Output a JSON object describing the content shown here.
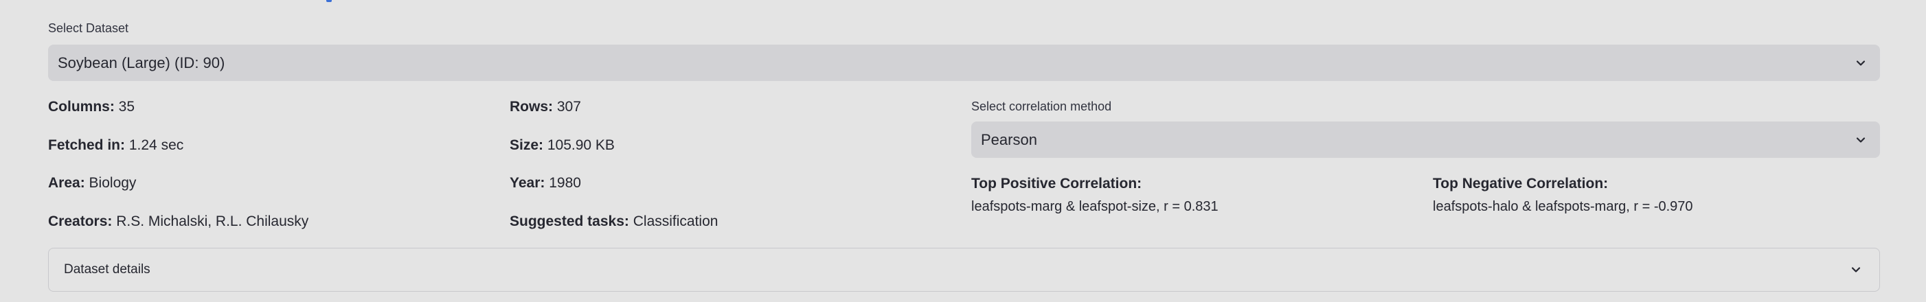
{
  "dataset_select": {
    "label": "Select Dataset",
    "value": "Soybean (Large) (ID: 90)"
  },
  "info": {
    "columns": {
      "label": "Columns:",
      "value": "35"
    },
    "rows": {
      "label": "Rows:",
      "value": "307"
    },
    "fetched_in": {
      "label": "Fetched in:",
      "value": "1.24 sec"
    },
    "size": {
      "label": "Size:",
      "value": "105.90 KB"
    },
    "area": {
      "label": "Area:",
      "value": "Biology"
    },
    "year": {
      "label": "Year:",
      "value": "1980"
    },
    "creators": {
      "label": "Creators:",
      "value": "R.S. Michalski, R.L. Chilausky"
    },
    "tasks": {
      "label": "Suggested tasks:",
      "value": "Classification"
    }
  },
  "correlation": {
    "label": "Select correlation method",
    "value": "Pearson",
    "top_positive": {
      "title": "Top Positive Correlation:",
      "value": "leafspots-marg & leafspot-size, r = 0.831"
    },
    "top_negative": {
      "title": "Top Negative Correlation:",
      "value": "leafspots-halo & leafspots-marg, r = -0.970"
    }
  },
  "details": {
    "label": "Dataset details"
  },
  "icons": {
    "select_chevron": "chevron-down-icon",
    "expander_chevron": "chevron-down-icon"
  }
}
